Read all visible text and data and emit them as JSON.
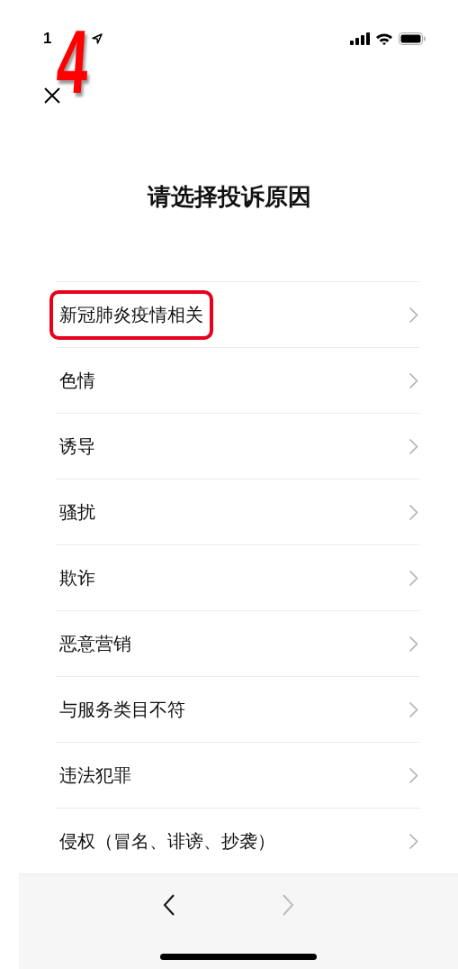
{
  "status_bar": {
    "time": "1"
  },
  "annotation": {
    "step": "4"
  },
  "title": "请选择投诉原因",
  "reasons": [
    {
      "label": "新冠肺炎疫情相关",
      "highlighted": true
    },
    {
      "label": "色情",
      "highlighted": false
    },
    {
      "label": "诱导",
      "highlighted": false
    },
    {
      "label": "骚扰",
      "highlighted": false
    },
    {
      "label": "欺诈",
      "highlighted": false
    },
    {
      "label": "恶意营销",
      "highlighted": false
    },
    {
      "label": "与服务类目不符",
      "highlighted": false
    },
    {
      "label": "违法犯罪",
      "highlighted": false
    },
    {
      "label": "侵权（冒名、诽谤、抄袭）",
      "highlighted": false
    }
  ],
  "nav": [
    {
      "kind": "back",
      "disabled": false
    },
    {
      "kind": "forward",
      "disabled": true
    }
  ]
}
